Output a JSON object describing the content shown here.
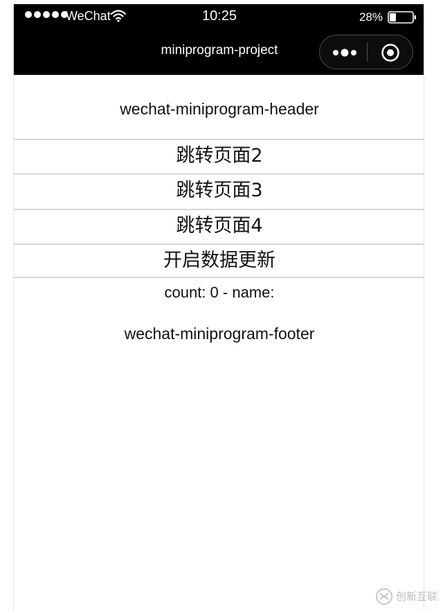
{
  "status_bar": {
    "carrier": "WeChat",
    "time": "10:25",
    "battery": "28%",
    "battery_level": 0.28,
    "signal_bars": 5
  },
  "nav": {
    "title": "miniprogram-project"
  },
  "content": {
    "header": "wechat-miniprogram-header",
    "buttons": [
      {
        "label": "跳转页面2"
      },
      {
        "label": "跳转页面3"
      },
      {
        "label": "跳转页面4"
      },
      {
        "label": "开启数据更新"
      }
    ],
    "count_line": "count: 0 - name:",
    "footer": "wechat-miniprogram-footer"
  },
  "watermark": {
    "text": "创新互联"
  },
  "colors": {
    "nav_background": "#000000",
    "page_background": "#ffffff",
    "text": "#111111",
    "button_border": "#d8d8d8"
  }
}
